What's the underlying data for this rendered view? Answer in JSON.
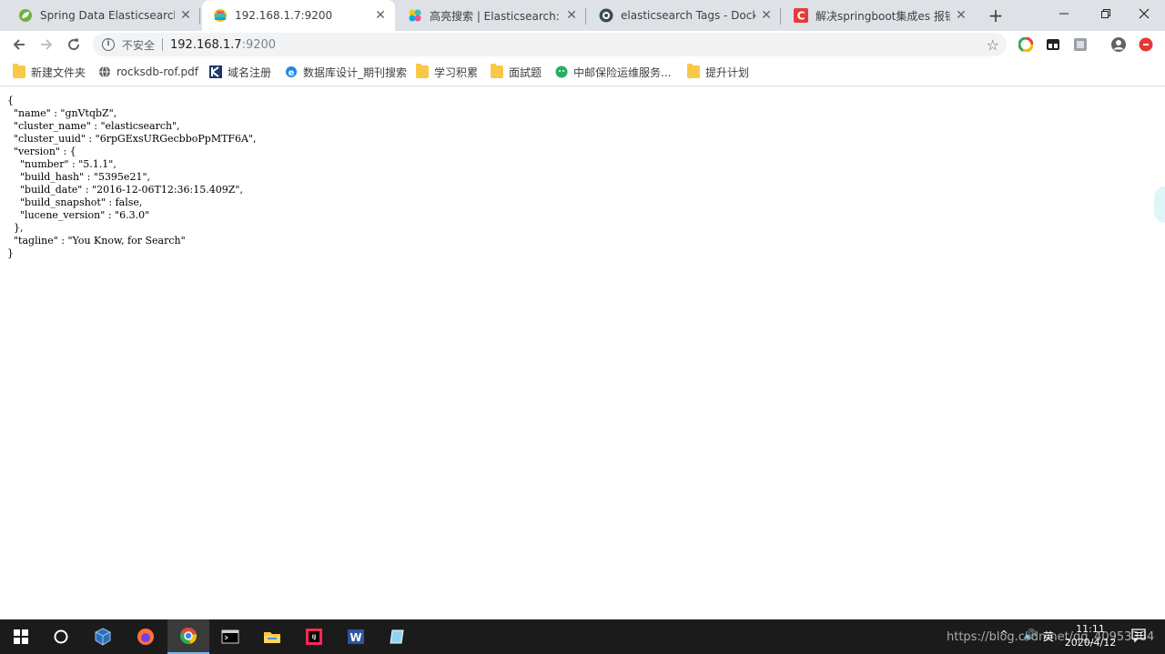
{
  "tabs": [
    {
      "title": "Spring Data Elasticsearch",
      "icon": "spring-leaf-icon",
      "active": false
    },
    {
      "title": "192.168.1.7:9200",
      "icon": "elastic-icon",
      "active": true
    },
    {
      "title": "高亮搜索 | Elasticsearch: 权威",
      "icon": "elastic-flower-icon",
      "active": false
    },
    {
      "title": "elasticsearch Tags - Docker",
      "icon": "docker-icon",
      "active": false
    },
    {
      "title": "解决springboot集成es 报错N",
      "icon": "csdn-icon",
      "active": false
    }
  ],
  "omnibox": {
    "security_label": "不安全",
    "host": "192.168.1.7",
    "port": ":9200"
  },
  "bookmarks": [
    {
      "label": "新建文件夹",
      "icon": "folder-icon"
    },
    {
      "label": "rocksdb-rof.pdf",
      "icon": "globe-icon"
    },
    {
      "label": "域名注册",
      "icon": "k-logo-icon"
    },
    {
      "label": "数据库设计_期刊搜索",
      "icon": "ie-icon"
    },
    {
      "label": "学习积累",
      "icon": "folder-icon"
    },
    {
      "label": "面試题",
      "icon": "folder-icon"
    },
    {
      "label": "中邮保险运维服务...",
      "icon": "wechat-icon"
    },
    {
      "label": "提升计划",
      "icon": "folder-icon"
    }
  ],
  "json_response": "{\n  \"name\" : \"gnVtqbZ\",\n  \"cluster_name\" : \"elasticsearch\",\n  \"cluster_uuid\" : \"6rpGExsURGecbboPpMTF6A\",\n  \"version\" : {\n    \"number\" : \"5.1.1\",\n    \"build_hash\" : \"5395e21\",\n    \"build_date\" : \"2016-12-06T12:36:15.409Z\",\n    \"build_snapshot\" : false,\n    \"lucene_version\" : \"6.3.0\"\n  },\n  \"tagline\" : \"You Know, for Search\"\n}",
  "taskbar": {
    "apps": [
      "windows-start-icon",
      "cortana-icon",
      "virtualbox-icon",
      "firefox-icon",
      "chrome-icon",
      "terminal-icon",
      "file-explorer-icon",
      "intellij-icon",
      "word-icon",
      "notepad-icon"
    ],
    "ime": "英",
    "time": "11:11",
    "date": "2020/4/12",
    "watermark": "https://blog.csdn.net/qq_40953384"
  },
  "colors": {
    "tabstrip": "#dee1e6",
    "taskbar": "#1b1b1b",
    "chrome_green": "#34a853",
    "elastic_yellow": "#f5c518"
  }
}
